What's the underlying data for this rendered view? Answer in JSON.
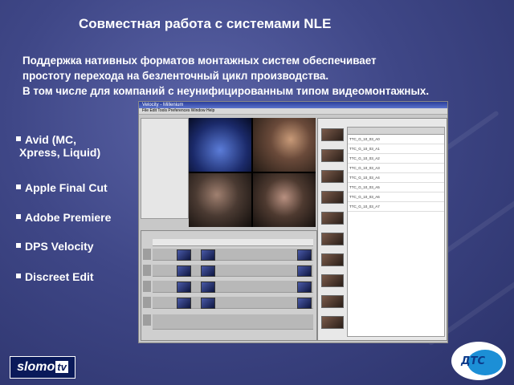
{
  "slide": {
    "title": "Совместная работа с  системами NLE",
    "intro": [
      "Поддержка нативных форматов монтажных систем обеспечивает",
      "простоту перехода на безленточный цикл производства.",
      "В том числе для компаний с неунифицированным типом видеомонтажных."
    ],
    "bullets": [
      {
        "line1": "Avid (MC,",
        "line2": "Xpress, Liquid)"
      },
      {
        "line1": "Apple Final Cut"
      },
      {
        "line1": "Adobe Premiere"
      },
      {
        "line1": "DPS Velocity"
      },
      {
        "line1": "Discreet Edit"
      }
    ]
  },
  "screenshot": {
    "titlebar": "Velocity - Millenium",
    "menubar": "File  Edit  Tools  Preferences  Window  Help",
    "bin_rows": [
      "TTC_G_10_03_A0",
      "TTC_G_10_03_A1",
      "TTC_G_10_03_A2",
      "TTC_G_10_03_A3",
      "TTC_G_10_03_A4",
      "TTC_G_10_03_A5",
      "TTC_G_10_03_A6",
      "TTC_G_10_03_A7"
    ]
  },
  "logos": {
    "slomo_main": "slomo",
    "slomo_suffix": "tv",
    "dts": "ДТС"
  },
  "colors": {
    "background": "#3f4787",
    "text": "#ffffff"
  }
}
